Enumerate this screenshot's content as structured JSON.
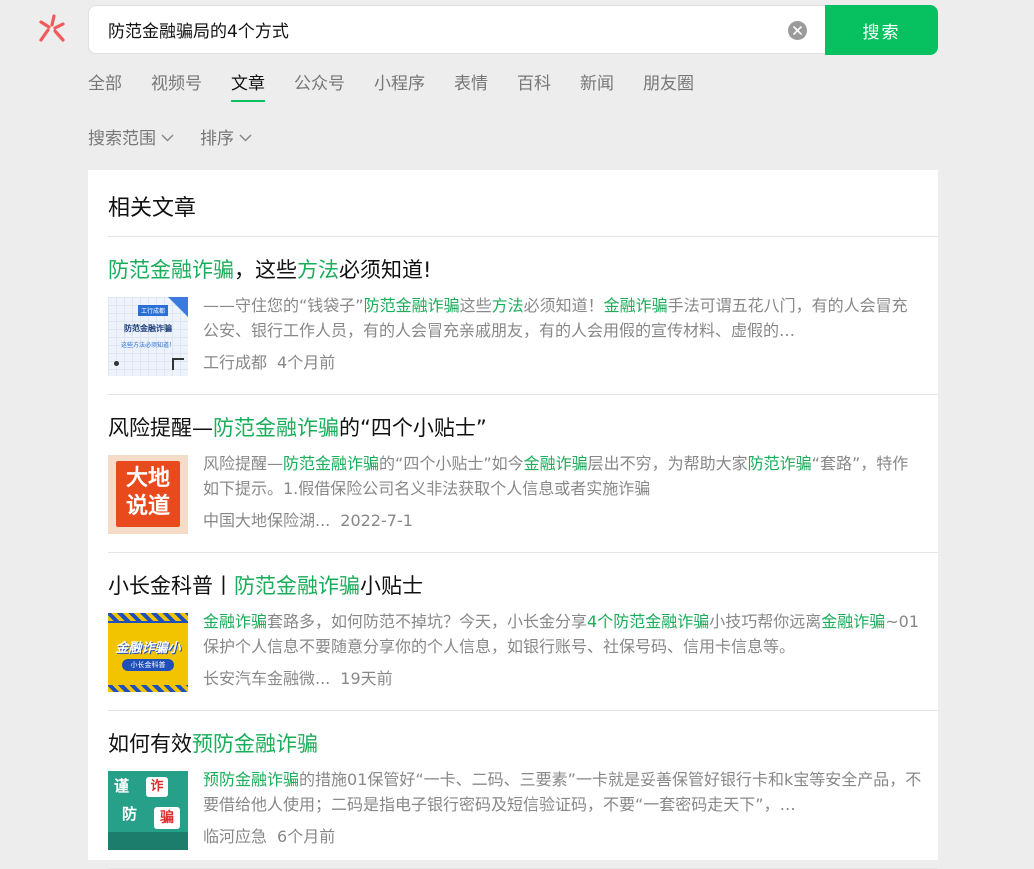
{
  "logo_icon": "wechat-search-logo-icon",
  "search": {
    "value": "防范金融骗局的4个方式",
    "clear_icon": "clear-icon",
    "button_label": "搜索",
    "accent": "#07c160"
  },
  "tabs": [
    {
      "label": "全部"
    },
    {
      "label": "视频号"
    },
    {
      "label": "文章",
      "active": true
    },
    {
      "label": "公众号"
    },
    {
      "label": "小程序"
    },
    {
      "label": "表情"
    },
    {
      "label": "百科"
    },
    {
      "label": "新闻"
    },
    {
      "label": "朋友圈"
    }
  ],
  "filters": [
    {
      "label": "搜索范围",
      "icon": "chevron-down-icon"
    },
    {
      "label": "排序",
      "icon": "chevron-down-icon"
    }
  ],
  "section_title": "相关文章",
  "highlight_color": "#1aad5a",
  "results": [
    {
      "title": [
        {
          "text": "防范金融诈骗",
          "hl": true
        },
        {
          "text": "，这些",
          "hl": false
        },
        {
          "text": "方法",
          "hl": true
        },
        {
          "text": "必须知道!",
          "hl": false
        }
      ],
      "snippet": [
        {
          "text": "——守住您的“钱袋子”",
          "hl": false
        },
        {
          "text": "防范金融诈骗",
          "hl": true
        },
        {
          "text": "这些",
          "hl": false
        },
        {
          "text": "方法",
          "hl": true
        },
        {
          "text": "必须知道！",
          "hl": false
        },
        {
          "text": "金融诈骗",
          "hl": true
        },
        {
          "text": "手法可谓五花八门，有的人会冒充公安、银行工作人员，有的人会冒充亲戚朋友，有的人会用假的宣传材料、虚假的…",
          "hl": false
        }
      ],
      "source": "工行成都",
      "time": "4个月前",
      "thumbnail": {
        "lines": [
          "工行成都",
          "防范金融诈骗",
          "这些方法必须知道！"
        ]
      }
    },
    {
      "title": [
        {
          "text": "风险提醒—",
          "hl": false
        },
        {
          "text": "防范金融诈骗",
          "hl": true
        },
        {
          "text": "的“四个小贴士”",
          "hl": false
        }
      ],
      "snippet": [
        {
          "text": "风险提醒—",
          "hl": false
        },
        {
          "text": "防范金融诈骗",
          "hl": true
        },
        {
          "text": "的“四个小贴士”如今",
          "hl": false
        },
        {
          "text": "金融诈骗",
          "hl": true
        },
        {
          "text": "层出不穷，为帮助大家",
          "hl": false
        },
        {
          "text": "防范诈骗",
          "hl": true
        },
        {
          "text": "“套路”，特作如下提示。1.假借保险公司名义非法获取个人信息或者实施诈骗",
          "hl": false
        }
      ],
      "source": "中国大地保险湖...",
      "time": "2022-7-1",
      "thumbnail": {
        "lines": [
          "大地",
          "说道"
        ]
      }
    },
    {
      "title": [
        {
          "text": "小长金科普丨",
          "hl": false
        },
        {
          "text": "防范金融诈骗",
          "hl": true
        },
        {
          "text": "小贴士",
          "hl": false
        }
      ],
      "snippet": [
        {
          "text": "金融诈骗",
          "hl": true
        },
        {
          "text": "套路多，如何防范不掉坑？今天，小长金分享",
          "hl": false
        },
        {
          "text": "4个防范金融诈骗",
          "hl": true
        },
        {
          "text": "小技巧帮你远离",
          "hl": false
        },
        {
          "text": "金融诈骗",
          "hl": true
        },
        {
          "text": "~01保护个人信息不要随意分享你的个人信息，如银行账号、社保号码、信用卡信息等。",
          "hl": false
        }
      ],
      "source": "长安汽车金融微...",
      "time": "19天前",
      "thumbnail": {
        "lines": [
          "金融诈骗小",
          "小长金科普"
        ]
      }
    },
    {
      "title": [
        {
          "text": "如何有效",
          "hl": false
        },
        {
          "text": "预防金融诈骗",
          "hl": true
        }
      ],
      "snippet": [
        {
          "text": "预防金融诈骗",
          "hl": true
        },
        {
          "text": "的措施01保管好“一卡、二码、三要素”一卡就是妥善保管好银行卡和k宝等安全产品，不要借给他人使用；二码是指电子银行密码及短信验证码，不要“一套密码走天下”，…",
          "hl": false
        }
      ],
      "source": "临河应急",
      "time": "6个月前",
      "thumbnail": {
        "lines": [
          "谨",
          "防",
          "诈",
          "骗"
        ]
      }
    }
  ]
}
